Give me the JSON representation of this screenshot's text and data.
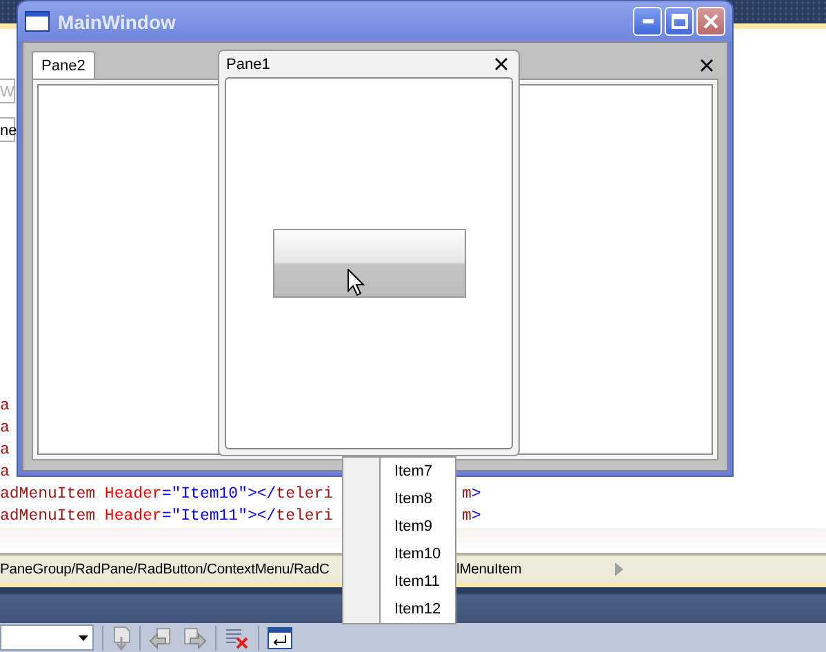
{
  "window": {
    "title": "MainWindow"
  },
  "tabs": [
    {
      "label": "Pane2",
      "selected": true
    }
  ],
  "floating_pane": {
    "title": "Pane1"
  },
  "context_menu": {
    "items": [
      "Item7",
      "Item8",
      "Item9",
      "Item10",
      "Item11",
      "Item12"
    ]
  },
  "editor": {
    "fields": [
      {
        "kind": "placeholder",
        "text": "W"
      },
      {
        "kind": "value",
        "text": "ne"
      }
    ],
    "code_lines": [
      {
        "segments": [
          {
            "kind": "element",
            "text": "a"
          }
        ]
      },
      {
        "segments": [
          {
            "kind": "element",
            "text": "a"
          }
        ]
      },
      {
        "segments": [
          {
            "kind": "element",
            "text": "a"
          }
        ]
      },
      {
        "segments": [
          {
            "kind": "element",
            "text": "a"
          }
        ]
      },
      {
        "segments": [
          {
            "kind": "element",
            "text": "adMenuItem"
          },
          {
            "kind": "attribute",
            "text": " Header"
          },
          {
            "kind": "punct",
            "text": "=\""
          },
          {
            "kind": "value",
            "text": "Item10"
          },
          {
            "kind": "punct",
            "text": "\"></"
          },
          {
            "kind": "element",
            "text": "teleri"
          }
        ],
        "tail": [
          {
            "kind": "element",
            "text": "m"
          },
          {
            "kind": "punct",
            "text": ">"
          }
        ]
      },
      {
        "segments": [
          {
            "kind": "element",
            "text": "adMenuItem"
          },
          {
            "kind": "attribute",
            "text": " Header"
          },
          {
            "kind": "punct",
            "text": "=\""
          },
          {
            "kind": "value",
            "text": "Item11"
          },
          {
            "kind": "punct",
            "text": "\"></"
          },
          {
            "kind": "element",
            "text": "teleri"
          }
        ],
        "tail": [
          {
            "kind": "element",
            "text": "m"
          },
          {
            "kind": "punct",
            "text": ">"
          }
        ]
      }
    ]
  },
  "breadcrumb": {
    "path": "PaneGroup/RadPane/RadButton/ContextMenu/RadC",
    "tail": "lMenuItem"
  }
}
